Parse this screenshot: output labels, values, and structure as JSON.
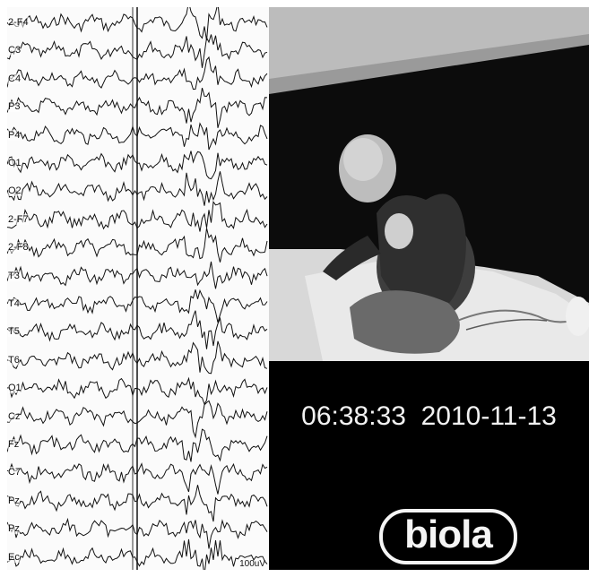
{
  "eeg": {
    "channels": [
      "2-F4",
      "C3",
      "C4",
      "P3",
      "P4",
      "O1",
      "O2",
      "2-F7",
      "2-F8",
      "T3",
      "T4",
      "T5",
      "T6",
      "O1",
      "Cz",
      "Fz",
      "C7",
      "Pz",
      "Pz",
      "Ec"
    ],
    "scale_label": "100uV"
  },
  "video": {
    "time": "06:38:33",
    "date": "2010-11-13",
    "logo_text": "biola"
  },
  "colors": {
    "trace": "#111111",
    "video_bg": "#000000",
    "text": "#f2f2f2"
  }
}
